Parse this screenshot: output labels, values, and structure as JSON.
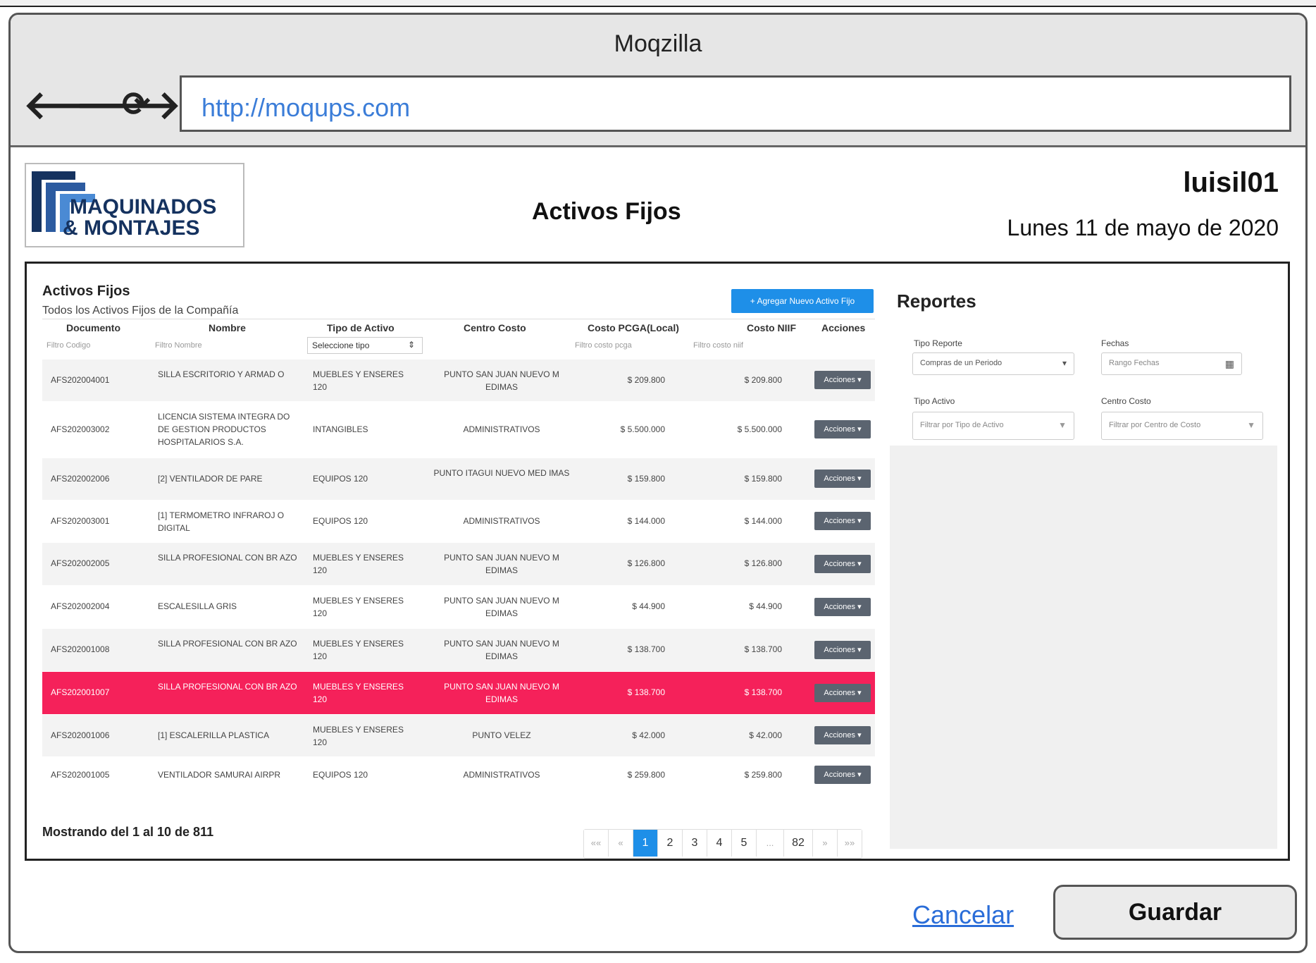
{
  "browser": {
    "title": "Moqzilla",
    "url": "http://moqups.com"
  },
  "header": {
    "logo_line1": "MAQUINADOS",
    "logo_line2": "& MONTAJES",
    "page_title": "Activos Fijos",
    "user": "luisil01",
    "date": "Lunes 11 de mayo de 2020"
  },
  "table_panel": {
    "title": "Activos Fijos",
    "subtitle": "Todos los Activos Fijos de la Compañía",
    "add_button": "+ Agregar Nuevo Activo Fijo",
    "columns": [
      "Documento",
      "Nombre",
      "Tipo de Activo",
      "Centro Costo",
      "Costo PCGA(Local)",
      "Costo NIIF",
      "Acciones"
    ],
    "filters": {
      "codigo": "Filtro Codigo",
      "nombre": "Filtro Nombre",
      "tipo": "Seleccione tipo",
      "pcga": "Filtro costo pcga",
      "niif": "Filtro costo niif"
    },
    "action_label": "Acciones ▾",
    "rows": [
      {
        "doc": "AFS202004001",
        "nombre": "SILLA ESCRITORIO Y ARMAD O",
        "tipo": "MUEBLES Y ENSERES 120",
        "centro": "PUNTO SAN JUAN NUEVO M EDIMAS",
        "pcga": "$ 209.800",
        "niif": "$ 209.800"
      },
      {
        "doc": "AFS202003002",
        "nombre": "LICENCIA SISTEMA INTEGRA DO DE GESTION PRODUCTOS HOSPITALARIOS S.A.",
        "tipo": "INTANGIBLES",
        "centro": "ADMINISTRATIVOS",
        "pcga": "$ 5.500.000",
        "niif": "$ 5.500.000"
      },
      {
        "doc": "AFS202002006",
        "nombre": "[2] VENTILADOR DE PARE",
        "tipo": "EQUIPOS 120",
        "centro": "PUNTO ITAGUI NUEVO MED IMAS",
        "pcga": "$ 159.800",
        "niif": "$ 159.800"
      },
      {
        "doc": "AFS202003001",
        "nombre": "[1] TERMOMETRO INFRAROJ O DIGITAL",
        "tipo": "EQUIPOS 120",
        "centro": "ADMINISTRATIVOS",
        "pcga": "$ 144.000",
        "niif": "$ 144.000"
      },
      {
        "doc": "AFS202002005",
        "nombre": "SILLA PROFESIONAL CON BR AZO",
        "tipo": "MUEBLES Y ENSERES 120",
        "centro": "PUNTO SAN JUAN NUEVO M EDIMAS",
        "pcga": "$ 126.800",
        "niif": "$ 126.800"
      },
      {
        "doc": "AFS202002004",
        "nombre": "ESCALESILLA GRIS",
        "tipo": "MUEBLES Y ENSERES 120",
        "centro": "PUNTO SAN JUAN NUEVO M EDIMAS",
        "pcga": "$ 44.900",
        "niif": "$ 44.900"
      },
      {
        "doc": "AFS202001008",
        "nombre": "SILLA PROFESIONAL CON BR AZO",
        "tipo": "MUEBLES Y ENSERES 120",
        "centro": "PUNTO SAN JUAN NUEVO M EDIMAS",
        "pcga": "$ 138.700",
        "niif": "$ 138.700"
      },
      {
        "doc": "AFS202001007",
        "nombre": "SILLA PROFESIONAL CON BR AZO",
        "tipo": "MUEBLES Y ENSERES 120",
        "centro": "PUNTO SAN JUAN NUEVO M EDIMAS",
        "pcga": "$ 138.700",
        "niif": "$ 138.700"
      },
      {
        "doc": "AFS202001006",
        "nombre": "[1] ESCALERILLA PLASTICA",
        "tipo": "MUEBLES Y ENSERES 120",
        "centro": "PUNTO VELEZ",
        "pcga": "$ 42.000",
        "niif": "$ 42.000"
      },
      {
        "doc": "AFS202001005",
        "nombre": "VENTILADOR SAMURAI AIRPR",
        "tipo": "EQUIPOS 120",
        "centro": "ADMINISTRATIVOS",
        "pcga": "$ 259.800",
        "niif": "$ 259.800"
      }
    ],
    "showing": "Mostrando del 1 al 10 de  811",
    "pagination": [
      "««",
      "«",
      "1",
      "2",
      "3",
      "4",
      "5",
      "...",
      "82",
      "»",
      "»»"
    ]
  },
  "reports": {
    "title": "Reportes",
    "tipo_reporte_label": "Tipo Reporte",
    "tipo_reporte_value": "Compras de un Periodo",
    "fechas_label": "Fechas",
    "fechas_placeholder": "Rango Fechas",
    "tipo_activo_label": "Tipo Activo",
    "tipo_activo_placeholder": "Filtrar por Tipo de Activo",
    "centro_costo_label": "Centro Costo",
    "centro_costo_placeholder": "Filtrar por Centro de Costo"
  },
  "footer": {
    "cancel": "Cancelar",
    "save": "Guardar"
  },
  "colors": {
    "accent": "#1e8fe8",
    "selected_row": "#f5215a",
    "action_button": "#5b6470",
    "link": "#2a6dd8"
  }
}
